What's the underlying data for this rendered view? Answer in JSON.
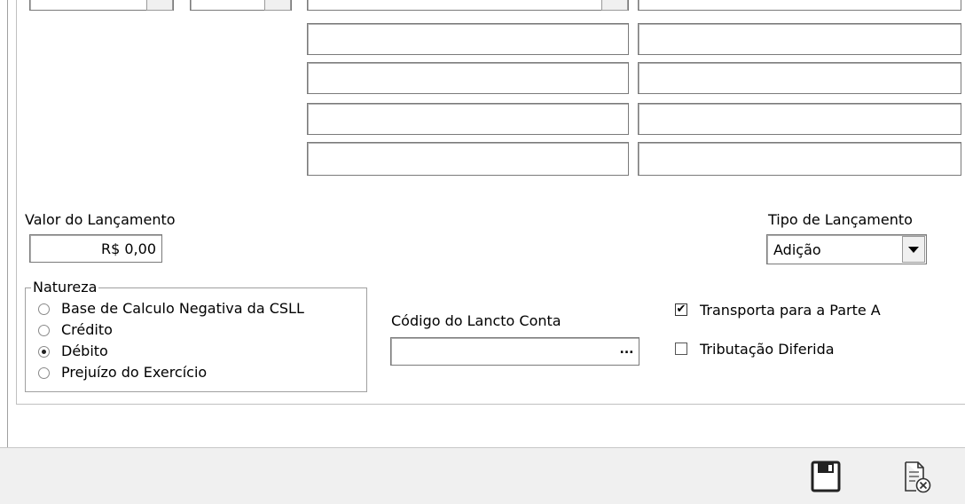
{
  "valor": {
    "label": "Valor do Lançamento",
    "value": "R$ 0,00"
  },
  "tipo": {
    "label": "Tipo de Lançamento",
    "selected": "Adição"
  },
  "natureza": {
    "label": "Natureza",
    "options": [
      {
        "label": "Base de Calculo Negativa da CSLL",
        "checked": false
      },
      {
        "label": "Crédito",
        "checked": false
      },
      {
        "label": "Débito",
        "checked": true
      },
      {
        "label": "Prejuízo do Exercício",
        "checked": false
      }
    ]
  },
  "codigo": {
    "label": "Código do Lancto Conta",
    "value": "",
    "button_label": "..."
  },
  "checks": [
    {
      "label": "Transporta para a Parte A",
      "checked": true
    },
    {
      "label": "Tributação Diferida",
      "checked": false
    }
  ],
  "footer": {
    "icons": [
      "save-icon",
      "cancel-document-icon"
    ]
  }
}
